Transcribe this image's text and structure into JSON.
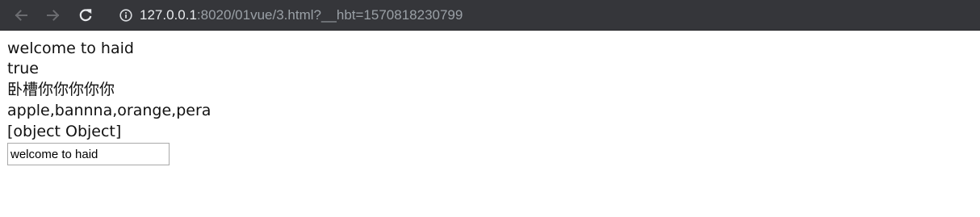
{
  "browser": {
    "url_host": "127.0.0.1",
    "url_rest": ":8020/01vue/3.html?__hbt=1570818230799",
    "icons": {
      "back": "arrow-left-icon",
      "forward": "arrow-right-icon",
      "reload": "reload-icon",
      "info": "info-icon"
    },
    "colors": {
      "toolbar_bg": "#35363a",
      "host_text": "#e8eaed",
      "path_text": "#9aa0a6"
    }
  },
  "page": {
    "lines": [
      "welcome to haid",
      "true",
      "卧槽你你你你你",
      "apple,bannna,orange,pera",
      "[object Object]"
    ],
    "input": {
      "value": "welcome to haid"
    }
  }
}
